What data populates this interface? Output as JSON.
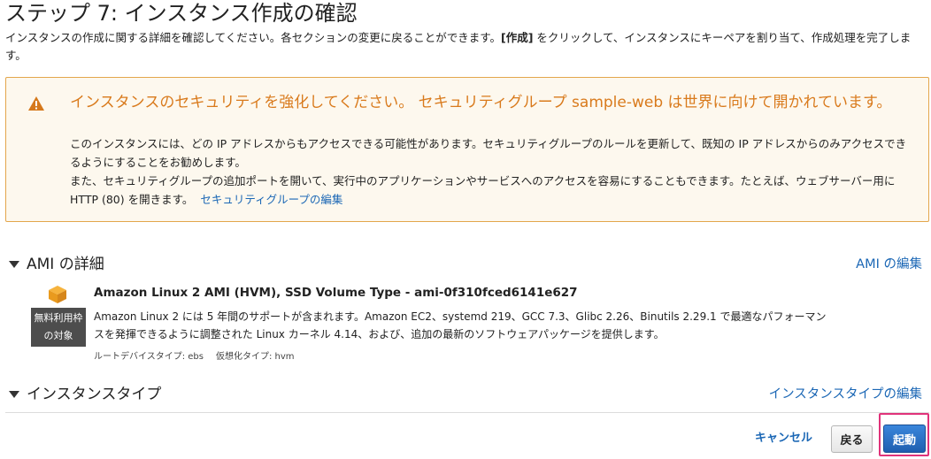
{
  "page": {
    "title": "ステップ 7: インスタンス作成の確認",
    "intro_before": "インスタンスの作成に関する詳細を確認してください。各セクションの変更に戻ることができます。",
    "intro_bold": "[作成]",
    "intro_after": " をクリックして、インスタンスにキーペアを割り当て、作成処理を完了します。"
  },
  "warning": {
    "icon": "warning-triangle-icon",
    "title": "インスタンスのセキュリティを強化してください。 セキュリティグループ sample-web は世界に向けて開かれています。",
    "line1": "このインスタンスには、どの IP アドレスからもアクセスできる可能性があります。セキュリティグループのルールを更新して、既知の IP アドレスからのみアクセスできるようにすることをお勧めします。",
    "line2": "また、セキュリティグループの追加ポートを開いて、実行中のアプリケーションやサービスへのアクセスを容易にすることもできます。たとえば、ウェブサーバー用に HTTP (80) を開きます。",
    "link": "セキュリティグループの編集"
  },
  "ami_section": {
    "title": "AMI の詳細",
    "edit": "AMI の編集",
    "icon": "cube-icon",
    "badge_line1": "無料利用枠",
    "badge_line2": "の対象",
    "name": "Amazon Linux 2 AMI (HVM), SSD Volume Type - ami-0f310fced6141e627",
    "description": "Amazon Linux 2 には 5 年間のサポートが含まれます。Amazon EC2、systemd 219、GCC 7.3、Glibc 2.26、Binutils 2.29.1 で最適なパフォーマンスを発揮できるように調整された Linux カーネル 4.14、および、追加の最新のソフトウェアパッケージを提供します。",
    "root_device": "ルートデバイスタイプ: ebs",
    "virt_type": "仮想化タイプ: hvm"
  },
  "instance_section": {
    "title": "インスタンスタイプ",
    "edit": "インスタンスタイプの編集"
  },
  "footer": {
    "cancel": "キャンセル",
    "back": "戻る",
    "launch": "起動"
  },
  "colors": {
    "warning_border": "#e3a64c",
    "warning_title": "#d97a1c",
    "link": "#1b67b5",
    "primary": "#2a72c7",
    "highlight": "#e0337a"
  }
}
